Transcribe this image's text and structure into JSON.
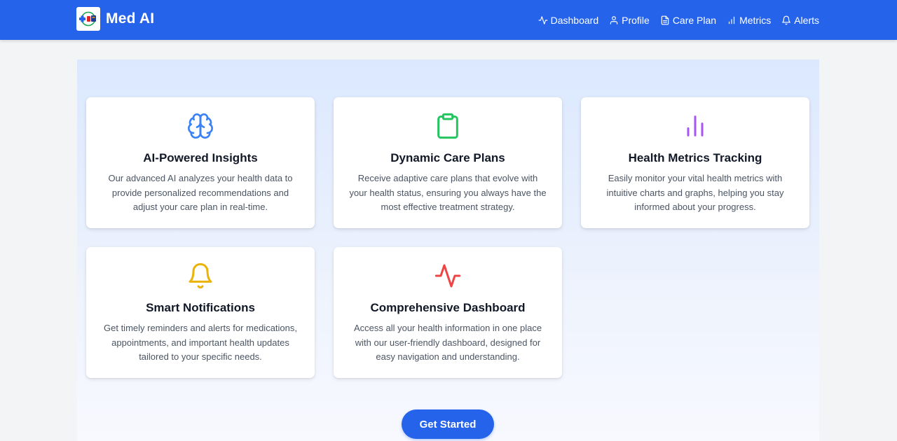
{
  "app": {
    "name": "Med AI"
  },
  "nav": [
    {
      "label": "Dashboard",
      "icon": "activity-icon"
    },
    {
      "label": "Profile",
      "icon": "user-icon"
    },
    {
      "label": "Care Plan",
      "icon": "file-text-icon"
    },
    {
      "label": "Metrics",
      "icon": "bar-chart-icon"
    },
    {
      "label": "Alerts",
      "icon": "bell-icon"
    }
  ],
  "features": [
    {
      "title": "AI-Powered Insights",
      "description": "Our advanced AI analyzes your health data to provide personalized recommendations and adjust your care plan in real-time.",
      "icon": "brain-icon",
      "color": "#3b82f6"
    },
    {
      "title": "Dynamic Care Plans",
      "description": "Receive adaptive care plans that evolve with your health status, ensuring you always have the most effective treatment strategy.",
      "icon": "clipboard-icon",
      "color": "#22c55e"
    },
    {
      "title": "Health Metrics Tracking",
      "description": "Easily monitor your vital health metrics with intuitive charts and graphs, helping you stay informed about your progress.",
      "icon": "bar-chart-icon",
      "color": "#a855f7"
    },
    {
      "title": "Smart Notifications",
      "description": "Get timely reminders and alerts for medications, appointments, and important health updates tailored to your specific needs.",
      "icon": "bell-icon",
      "color": "#eab308"
    },
    {
      "title": "Comprehensive Dashboard",
      "description": "Access all your health information in one place with our user-friendly dashboard, designed for easy navigation and understanding.",
      "icon": "activity-icon",
      "color": "#ef4444"
    }
  ],
  "cta": {
    "label": "Get Started"
  },
  "colors": {
    "primary": "#2563eb"
  }
}
